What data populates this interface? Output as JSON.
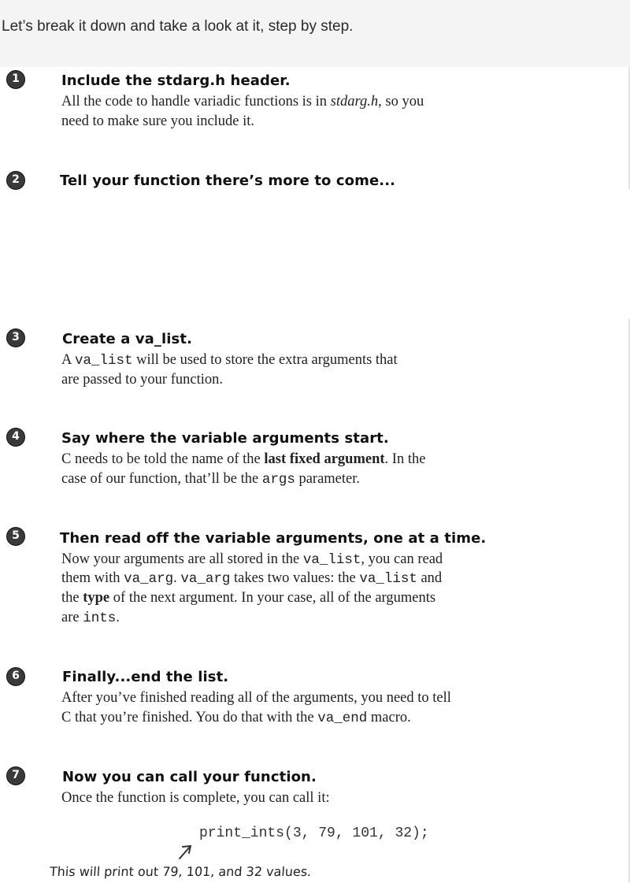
{
  "intro": "Let’s break it down and take a look at it, step by step.",
  "steps": [
    {
      "num": "1",
      "title": "Include the stdarg.h header.",
      "line1": {
        "a": "All the code to handle variadic functions is in ",
        "b": "stdarg.h",
        "c": ", so you"
      },
      "line2": "need to make sure you include it."
    },
    {
      "num": "2",
      "title": "Tell your function there’s more to come..."
    },
    {
      "num": "3",
      "title": "Create a va_list.",
      "line1": {
        "a": "A ",
        "b": "va_list",
        "c": " will be used to store the extra arguments that"
      },
      "line2": "are passed to your function."
    },
    {
      "num": "4",
      "title": "Say where the variable arguments start.",
      "line1": {
        "a": "C needs to be told the name of the ",
        "b": "last fixed argument",
        "c": ". In the"
      },
      "line2": {
        "a": "case of our function, that’ll be the ",
        "b": "args",
        "c": " parameter."
      }
    },
    {
      "num": "5",
      "title": "Then read off the variable arguments, one at a time.",
      "line1": {
        "a": "Now your arguments are all stored in the ",
        "b": "va_list",
        "c": ", you can read"
      },
      "line2": {
        "a": "them with ",
        "b": "va_arg",
        "c": ". ",
        "d": "va_arg",
        "e": " takes two values: the ",
        "f": "va_list",
        "g": " and"
      },
      "line3": {
        "a": "the ",
        "b": "type",
        "c": " of the next argument. In your case, all of the arguments"
      },
      "line4": {
        "a": "are ",
        "b": "ints",
        "c": "."
      }
    },
    {
      "num": "6",
      "title": "Finally...end the list.",
      "line1": "After you’ve finished reading all of the arguments, you need to tell",
      "line2": {
        "a": "C that you’re finished. You do that with the ",
        "b": "va_end",
        "c": " macro."
      }
    },
    {
      "num": "7",
      "title": "Now you can call your function.",
      "line1": "Once the function is complete, you can call it:"
    }
  ],
  "code": "print_ints(3, 79, 101, 32);",
  "note": "This will print out 79, 101, and 32 values.",
  "colors": {
    "badge": "#3a3a3a",
    "intro_bg": "#f4f4f4"
  },
  "icons": {
    "arrow": "hand-drawn-arrow-icon"
  }
}
